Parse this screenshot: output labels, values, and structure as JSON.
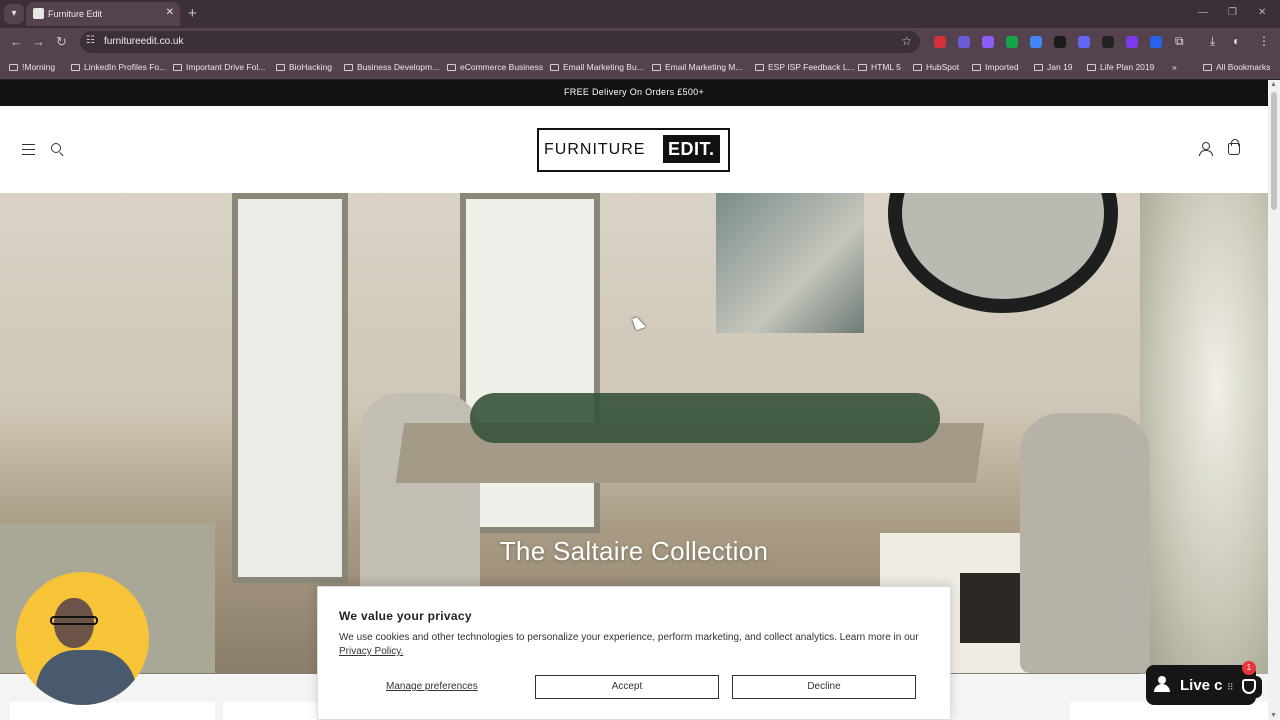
{
  "browser": {
    "tab_title": "Furniture Edit",
    "tab_close": "✕",
    "new_tab": "+",
    "url": "furnitureedit.co.uk",
    "window_controls": [
      "—",
      "❐",
      "✕"
    ],
    "bookmarks": [
      "!Morning",
      "LinkedIn Profiles Fo...",
      "Important Drive Fol...",
      "BioHacking",
      "Business Developm...",
      "eCommerce Business",
      "Email Marketing Bu...",
      "Email Marketing M...",
      "ESP ISP Feedback L...",
      "HTML 5",
      "HubSpot",
      "Imported",
      "Jan 19",
      "Life Plan 2019"
    ],
    "bookmarks_overflow": "»",
    "all_bookmarks": "All Bookmarks",
    "extension_colors": [
      "#d3323b",
      "#6b5bd6",
      "#8b5cf6",
      "#16a34a",
      "#4285f4",
      "#1a1a1a",
      "#6366f1",
      "#222222",
      "#7c3aed",
      "#2563eb"
    ]
  },
  "site": {
    "announcement": "FREE Delivery On Orders £500+",
    "logo_word1": "FURNITURE",
    "logo_word2": "EDIT.",
    "hero_title": "The Saltaire Collection"
  },
  "cookie_banner": {
    "heading": "We value your privacy",
    "body": "We use cookies and other technologies to personalize your experience, perform marketing, and collect analytics. Learn more in our",
    "privacy_link": "Privacy Policy.",
    "manage": "Manage preferences",
    "accept": "Accept",
    "decline": "Decline"
  },
  "live_chat": {
    "label": "Live c",
    "badge": "1"
  }
}
